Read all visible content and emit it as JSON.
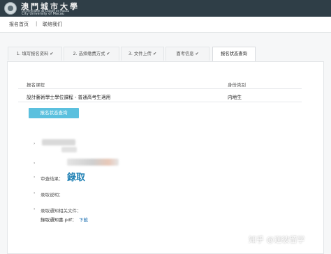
{
  "header": {
    "logo_zh": "澳門城市大學",
    "logo_pt": "Universidade da Cidade de Macau",
    "logo_en": "City University of Macau"
  },
  "nav": {
    "home": "报名首页",
    "separator": "|",
    "contact": "联络我们"
  },
  "steps": [
    {
      "label": "1. 填写报名资料",
      "done": true
    },
    {
      "label": "2. 选择缴费方式",
      "done": true
    },
    {
      "label": "3. 文件上传",
      "done": true
    },
    {
      "label": "面考信息",
      "done": true
    },
    {
      "label": "报名状态查询",
      "done": false
    }
  ],
  "check_glyph": "✔",
  "form": {
    "course_label": "报名课程",
    "course_value": "設計藝術學士學位課程 - 普通高考生適用",
    "identity_label": "身份类别",
    "identity_value": "内地生"
  },
  "query_button": "报名状态查询",
  "result": {
    "bullet": "›",
    "review_label": "审查结果：",
    "review_value": "錄取",
    "note_label": "录取说明：",
    "files_label": "录取通知相关文件：",
    "file_name": "錄取通知書.pdf：",
    "download_link": "下載"
  },
  "watermark": "知乎 @迦彼留学"
}
